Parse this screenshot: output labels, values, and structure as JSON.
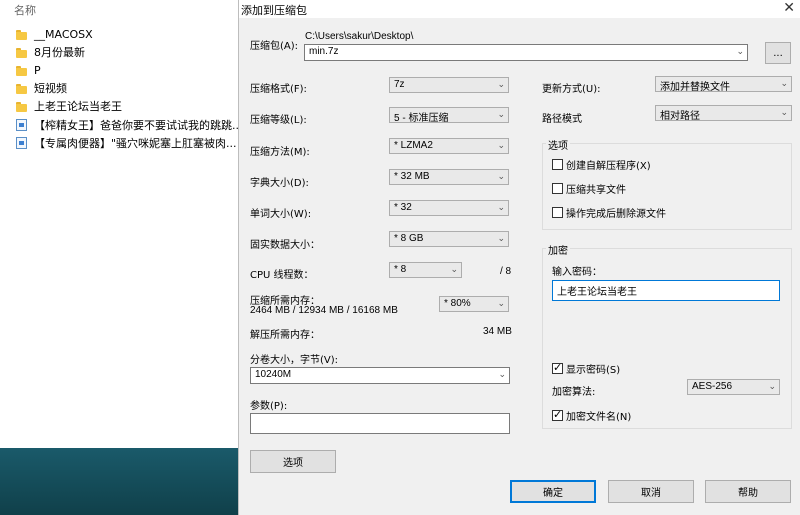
{
  "explorer": {
    "column_name": "名称",
    "items": [
      {
        "name": "__MACOSX",
        "kind": "folder"
      },
      {
        "name": "8月份最新",
        "kind": "folder"
      },
      {
        "name": "P",
        "kind": "folder"
      },
      {
        "name": "短视频",
        "kind": "folder"
      },
      {
        "name": "上老王论坛当老王",
        "kind": "folder"
      },
      {
        "name": "【榨精女王】爸爸你要不要试试我的跳跳...",
        "kind": "file"
      },
      {
        "name": "【专属肉便器】\"骚穴咪妮塞上肛塞被肉...",
        "kind": "file"
      }
    ]
  },
  "dialog": {
    "title": "添加到压缩包",
    "close": "✕",
    "archive_label": "压缩包(A):",
    "archive_path": "C:\\Users\\sakur\\Desktop\\",
    "archive_name": "min.7z",
    "browse": "...",
    "format_label": "压缩格式(F):",
    "format_value": "7z",
    "level_label": "压缩等级(L):",
    "level_value": "5 - 标准压缩",
    "method_label": "压缩方法(M):",
    "method_value": "* LZMA2",
    "dict_label": "字典大小(D):",
    "dict_value": "* 32 MB",
    "word_label": "单词大小(W):",
    "word_value": "* 32",
    "solid_label": "固实数据大小：",
    "solid_value": "* 8 GB",
    "cpu_label": "CPU 线程数：",
    "cpu_value": "* 8",
    "cpu_max": "/ 8",
    "mem_comp_label": "压缩所需内存：",
    "mem_comp_value": "2464 MB / 12934 MB / 16168 MB",
    "mem_percent": "* 80%",
    "mem_decomp_label": "解压所需内存：",
    "mem_decomp_value": "34 MB",
    "split_label": "分卷大小，字节(V):",
    "split_value": "10240M",
    "params_label": "参数(P):",
    "params_value": "",
    "options_button": "选项",
    "update_label": "更新方式(U):",
    "update_value": "添加并替换文件",
    "path_label": "路径模式",
    "path_value": "相对路径",
    "options_group": "选项",
    "opt_sfx": "创建自解压程序(X)",
    "opt_shared": "压缩共享文件",
    "opt_delete": "操作完成后删除源文件",
    "enc_group": "加密",
    "enc_pw_label": "输入密码：",
    "enc_pw_value": "上老王论坛当老王",
    "enc_show": "显示密码(S)",
    "enc_method_label": "加密算法:",
    "enc_method_value": "AES-256",
    "enc_names": "加密文件名(N)",
    "ok": "确定",
    "cancel": "取消",
    "help": "帮助"
  }
}
